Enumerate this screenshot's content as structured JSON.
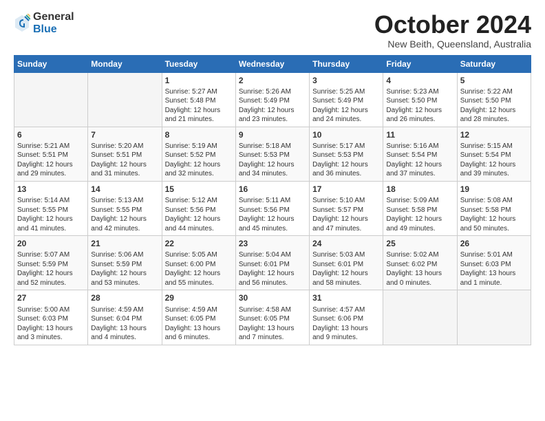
{
  "logo": {
    "general": "General",
    "blue": "Blue"
  },
  "header": {
    "month": "October 2024",
    "location": "New Beith, Queensland, Australia"
  },
  "days_of_week": [
    "Sunday",
    "Monday",
    "Tuesday",
    "Wednesday",
    "Thursday",
    "Friday",
    "Saturday"
  ],
  "weeks": [
    [
      {
        "day": "",
        "empty": true
      },
      {
        "day": "",
        "empty": true
      },
      {
        "day": "1",
        "sunrise": "5:27 AM",
        "sunset": "5:48 PM",
        "daylight": "12 hours and 21 minutes."
      },
      {
        "day": "2",
        "sunrise": "5:26 AM",
        "sunset": "5:49 PM",
        "daylight": "12 hours and 23 minutes."
      },
      {
        "day": "3",
        "sunrise": "5:25 AM",
        "sunset": "5:49 PM",
        "daylight": "12 hours and 24 minutes."
      },
      {
        "day": "4",
        "sunrise": "5:23 AM",
        "sunset": "5:50 PM",
        "daylight": "12 hours and 26 minutes."
      },
      {
        "day": "5",
        "sunrise": "5:22 AM",
        "sunset": "5:50 PM",
        "daylight": "12 hours and 28 minutes."
      }
    ],
    [
      {
        "day": "6",
        "sunrise": "5:21 AM",
        "sunset": "5:51 PM",
        "daylight": "12 hours and 29 minutes."
      },
      {
        "day": "7",
        "sunrise": "5:20 AM",
        "sunset": "5:51 PM",
        "daylight": "12 hours and 31 minutes."
      },
      {
        "day": "8",
        "sunrise": "5:19 AM",
        "sunset": "5:52 PM",
        "daylight": "12 hours and 32 minutes."
      },
      {
        "day": "9",
        "sunrise": "5:18 AM",
        "sunset": "5:53 PM",
        "daylight": "12 hours and 34 minutes."
      },
      {
        "day": "10",
        "sunrise": "5:17 AM",
        "sunset": "5:53 PM",
        "daylight": "12 hours and 36 minutes."
      },
      {
        "day": "11",
        "sunrise": "5:16 AM",
        "sunset": "5:54 PM",
        "daylight": "12 hours and 37 minutes."
      },
      {
        "day": "12",
        "sunrise": "5:15 AM",
        "sunset": "5:54 PM",
        "daylight": "12 hours and 39 minutes."
      }
    ],
    [
      {
        "day": "13",
        "sunrise": "5:14 AM",
        "sunset": "5:55 PM",
        "daylight": "12 hours and 41 minutes."
      },
      {
        "day": "14",
        "sunrise": "5:13 AM",
        "sunset": "5:55 PM",
        "daylight": "12 hours and 42 minutes."
      },
      {
        "day": "15",
        "sunrise": "5:12 AM",
        "sunset": "5:56 PM",
        "daylight": "12 hours and 44 minutes."
      },
      {
        "day": "16",
        "sunrise": "5:11 AM",
        "sunset": "5:56 PM",
        "daylight": "12 hours and 45 minutes."
      },
      {
        "day": "17",
        "sunrise": "5:10 AM",
        "sunset": "5:57 PM",
        "daylight": "12 hours and 47 minutes."
      },
      {
        "day": "18",
        "sunrise": "5:09 AM",
        "sunset": "5:58 PM",
        "daylight": "12 hours and 49 minutes."
      },
      {
        "day": "19",
        "sunrise": "5:08 AM",
        "sunset": "5:58 PM",
        "daylight": "12 hours and 50 minutes."
      }
    ],
    [
      {
        "day": "20",
        "sunrise": "5:07 AM",
        "sunset": "5:59 PM",
        "daylight": "12 hours and 52 minutes."
      },
      {
        "day": "21",
        "sunrise": "5:06 AM",
        "sunset": "5:59 PM",
        "daylight": "12 hours and 53 minutes."
      },
      {
        "day": "22",
        "sunrise": "5:05 AM",
        "sunset": "6:00 PM",
        "daylight": "12 hours and 55 minutes."
      },
      {
        "day": "23",
        "sunrise": "5:04 AM",
        "sunset": "6:01 PM",
        "daylight": "12 hours and 56 minutes."
      },
      {
        "day": "24",
        "sunrise": "5:03 AM",
        "sunset": "6:01 PM",
        "daylight": "12 hours and 58 minutes."
      },
      {
        "day": "25",
        "sunrise": "5:02 AM",
        "sunset": "6:02 PM",
        "daylight": "13 hours and 0 minutes."
      },
      {
        "day": "26",
        "sunrise": "5:01 AM",
        "sunset": "6:03 PM",
        "daylight": "13 hours and 1 minute."
      }
    ],
    [
      {
        "day": "27",
        "sunrise": "5:00 AM",
        "sunset": "6:03 PM",
        "daylight": "13 hours and 3 minutes."
      },
      {
        "day": "28",
        "sunrise": "4:59 AM",
        "sunset": "6:04 PM",
        "daylight": "13 hours and 4 minutes."
      },
      {
        "day": "29",
        "sunrise": "4:59 AM",
        "sunset": "6:05 PM",
        "daylight": "13 hours and 6 minutes."
      },
      {
        "day": "30",
        "sunrise": "4:58 AM",
        "sunset": "6:05 PM",
        "daylight": "13 hours and 7 minutes."
      },
      {
        "day": "31",
        "sunrise": "4:57 AM",
        "sunset": "6:06 PM",
        "daylight": "13 hours and 9 minutes."
      },
      {
        "day": "",
        "empty": true
      },
      {
        "day": "",
        "empty": true
      }
    ]
  ]
}
